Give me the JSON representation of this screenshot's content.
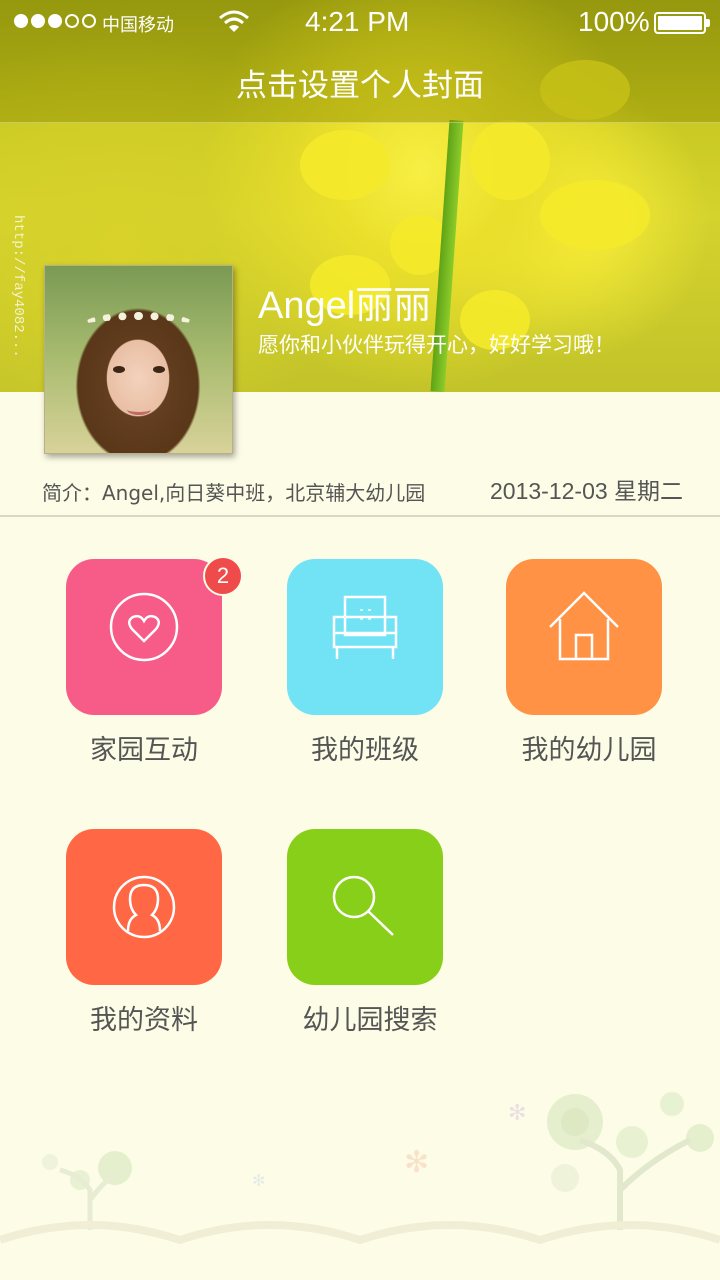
{
  "status_bar": {
    "carrier": "中国移动",
    "time": "4:21 PM",
    "battery": "100%"
  },
  "header": {
    "title": "点击设置个人封面"
  },
  "cover": {
    "watermark": "http://fay4082..."
  },
  "profile": {
    "name": "Angel丽丽",
    "motto": "愿你和小伙伴玩得开心，好好学习哦！",
    "intro": "简介：Angel,向日葵中班，北京辅大幼儿园",
    "date": "2013-12-03  星期二"
  },
  "menu": [
    {
      "label": "家园互动",
      "icon": "heart-circle-icon",
      "color": "#f75c88",
      "badge": "2"
    },
    {
      "label": "我的班级",
      "icon": "chair-icon",
      "color": "#72e3f5"
    },
    {
      "label": "我的幼儿园",
      "icon": "house-icon",
      "color": "#ff9245"
    },
    {
      "label": "我的资料",
      "icon": "user-circle-icon",
      "color": "#ff6745"
    },
    {
      "label": "幼儿园搜索",
      "icon": "search-icon",
      "color": "#88cf19"
    }
  ]
}
